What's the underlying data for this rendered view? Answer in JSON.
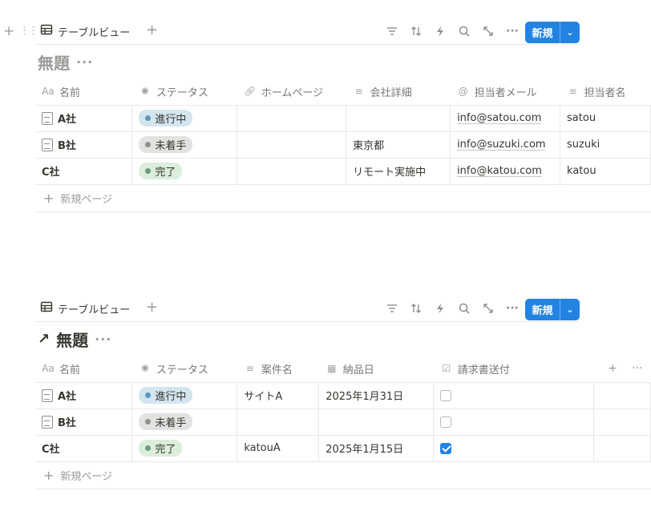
{
  "colors": {
    "accent": "#2383e2",
    "in_progress": "#d3e5ef",
    "not_started": "#e3e2e0",
    "done": "#dbeddb"
  },
  "view1": {
    "tab_label": "テーブルビュー",
    "new_button": "新規",
    "title": "無題",
    "columns": [
      "名前",
      "ステータス",
      "ホームページ",
      "会社詳細",
      "担当者メール",
      "担当者名"
    ],
    "rows": [
      {
        "name": "A社",
        "status": "進行中",
        "homepage": "",
        "details": "",
        "email": "info@satou.com",
        "contact": "satou"
      },
      {
        "name": "B社",
        "status": "未着手",
        "homepage": "",
        "details": "東京都",
        "email": "info@suzuki.com",
        "contact": "suzuki"
      },
      {
        "name": "C社",
        "status": "完了",
        "homepage": "",
        "details": "リモート実施中",
        "email": "info@katou.com",
        "contact": "katou"
      }
    ],
    "new_page": "新規ページ"
  },
  "view2": {
    "tab_label": "テーブルビュー",
    "new_button": "新規",
    "title": "無題",
    "columns": [
      "名前",
      "ステータス",
      "案件名",
      "納品日",
      "請求書送付"
    ],
    "rows": [
      {
        "name": "A社",
        "status": "進行中",
        "project": "サイトA",
        "delivery": "2025年1月31日",
        "invoice_sent": false
      },
      {
        "name": "B社",
        "status": "未着手",
        "project": "",
        "delivery": "",
        "invoice_sent": false
      },
      {
        "name": "C社",
        "status": "完了",
        "project": "katouA",
        "delivery": "2025年1月15日",
        "invoice_sent": true
      }
    ],
    "new_page": "新規ページ"
  },
  "icons": {
    "aa": "Aa",
    "status": "status-icon",
    "link": "link-icon",
    "text": "text-lines-icon",
    "at": "@",
    "calendar": "calendar-icon",
    "checkbox": "checkbox-icon"
  }
}
